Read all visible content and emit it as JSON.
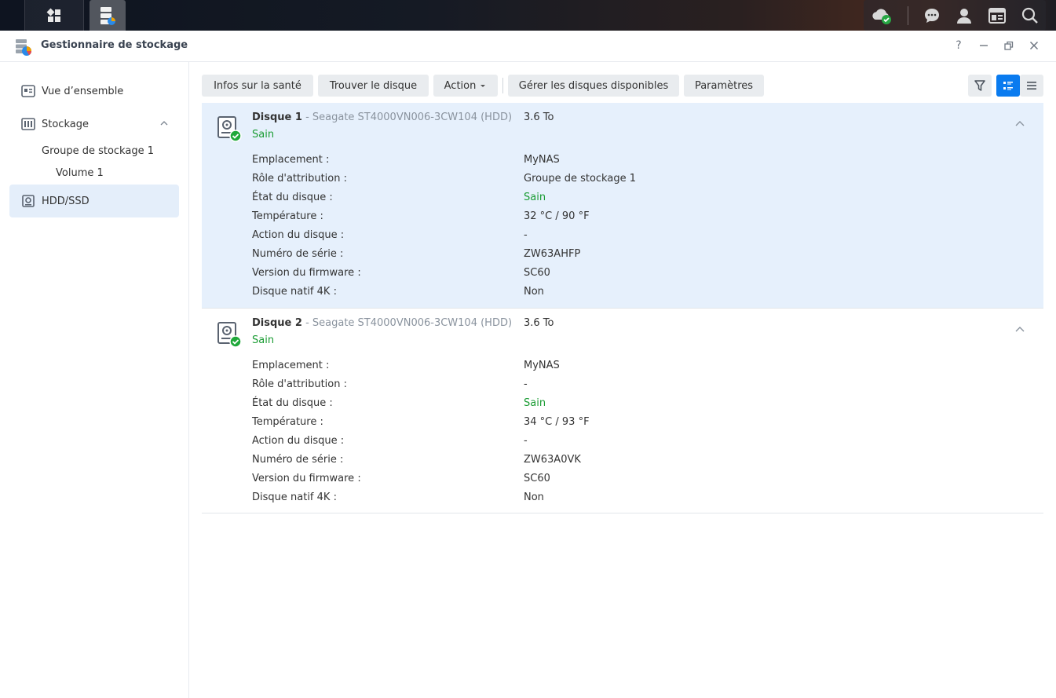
{
  "window": {
    "title": "Gestionnaire de stockage",
    "help": "?"
  },
  "sidebar": {
    "items": [
      {
        "label": "Vue d’ensemble"
      },
      {
        "label": "Stockage"
      },
      {
        "label": "HDD/SSD"
      }
    ],
    "sub": [
      {
        "label": "Groupe de stockage 1"
      },
      {
        "label": "Volume 1"
      }
    ]
  },
  "toolbar": {
    "health": "Infos sur la santé",
    "find": "Trouver le disque",
    "action": "Action",
    "manage": "Gérer les disques disponibles",
    "settings": "Paramètres"
  },
  "disks": [
    {
      "name": "Disque 1",
      "model": " - Seagate ST4000VN006-3CW104 (HDD)",
      "size": "3.6 To",
      "status": "Sain",
      "fields": [
        {
          "label": "Emplacement :",
          "value": "MyNAS"
        },
        {
          "label": "Rôle d'attribution :",
          "value": "Groupe de stockage 1"
        },
        {
          "label": "État du disque :",
          "value": "Sain"
        },
        {
          "label": "Température :",
          "value": "32 °C / 90 °F"
        },
        {
          "label": "Action du disque :",
          "value": "-"
        },
        {
          "label": "Numéro de série :",
          "value": "ZW63AHFP"
        },
        {
          "label": "Version du firmware :",
          "value": "SC60"
        },
        {
          "label": "Disque natif 4K :",
          "value": "Non"
        }
      ]
    },
    {
      "name": "Disque 2",
      "model": " - Seagate ST4000VN006-3CW104 (HDD)",
      "size": "3.6 To",
      "status": "Sain",
      "fields": [
        {
          "label": "Emplacement :",
          "value": "MyNAS"
        },
        {
          "label": "Rôle d'attribution :",
          "value": "-"
        },
        {
          "label": "État du disque :",
          "value": "Sain"
        },
        {
          "label": "Température :",
          "value": "34 °C / 93 °F"
        },
        {
          "label": "Action du disque :",
          "value": "-"
        },
        {
          "label": "Numéro de série :",
          "value": "ZW63A0VK"
        },
        {
          "label": "Version du firmware :",
          "value": "SC60"
        },
        {
          "label": "Disque natif 4K :",
          "value": "Non"
        }
      ]
    }
  ],
  "colors": {
    "accent": "#0a7bef",
    "healthy": "#1a9c33",
    "selected": "#e6f0fc"
  }
}
